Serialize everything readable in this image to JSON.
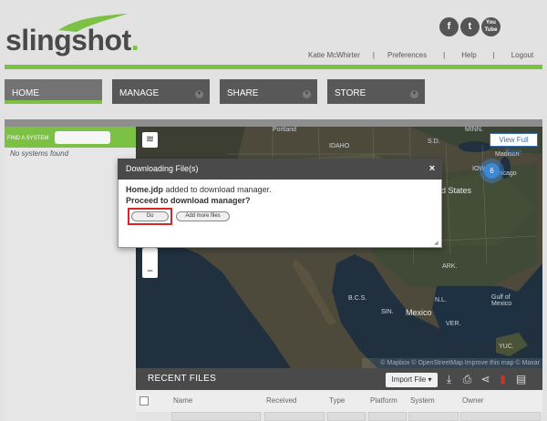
{
  "brand": {
    "logo_text": "slingshot",
    "logo_dot": "."
  },
  "social": [
    {
      "name": "facebook-icon",
      "glyph": "f"
    },
    {
      "name": "twitter-icon",
      "glyph": "t"
    },
    {
      "name": "youtube-icon",
      "glyph": "You\nTube"
    }
  ],
  "topnav": {
    "user": "Katie McWhirter",
    "preferences": "Preferences",
    "help": "Help",
    "logout": "Logout",
    "separator": "|"
  },
  "tabs": [
    {
      "label": "HOME"
    },
    {
      "label": "MANAGE"
    },
    {
      "label": "SHARE"
    },
    {
      "label": "STORE"
    }
  ],
  "sidebar": {
    "find_label": "FIND A SYSTEM",
    "find_value": "",
    "no_systems": "No systems found"
  },
  "map": {
    "view_full_page": "View Full Page",
    "cluster_count": "6",
    "attribution": "© Mapbox © OpenStreetMap Improve this map © Maxar",
    "labels": {
      "portland": "Portland",
      "idaho": "IDAHO",
      "sd": "S.D.",
      "minn": "MINN.",
      "madison": "Madison",
      "iowa": "IOW",
      "chicago": "Chicago",
      "states": "ed States",
      "ark": "ARK.",
      "mexico": "Mexico",
      "gulf": "Gulf of\nMexico",
      "bcs": "B.C.S.",
      "sin": "SIN.",
      "ver": "VER.",
      "yuc": "YUC.",
      "nl": "N.L."
    }
  },
  "dialog": {
    "title": "Downloading File(s)",
    "close": "×",
    "file": "Home.jdp",
    "message": " added to download manager.",
    "question": "Proceed to download manager?",
    "go": "Go",
    "add_more": "Add more files"
  },
  "recent": {
    "title": "RECENT FILES",
    "import_label": "Import File",
    "columns": [
      "Name",
      "Received",
      "Type",
      "Platform",
      "System",
      "Owner"
    ]
  },
  "colors": {
    "accent": "#7bc143",
    "dark": "#4a4a4a",
    "highlight": "#d9252a"
  }
}
